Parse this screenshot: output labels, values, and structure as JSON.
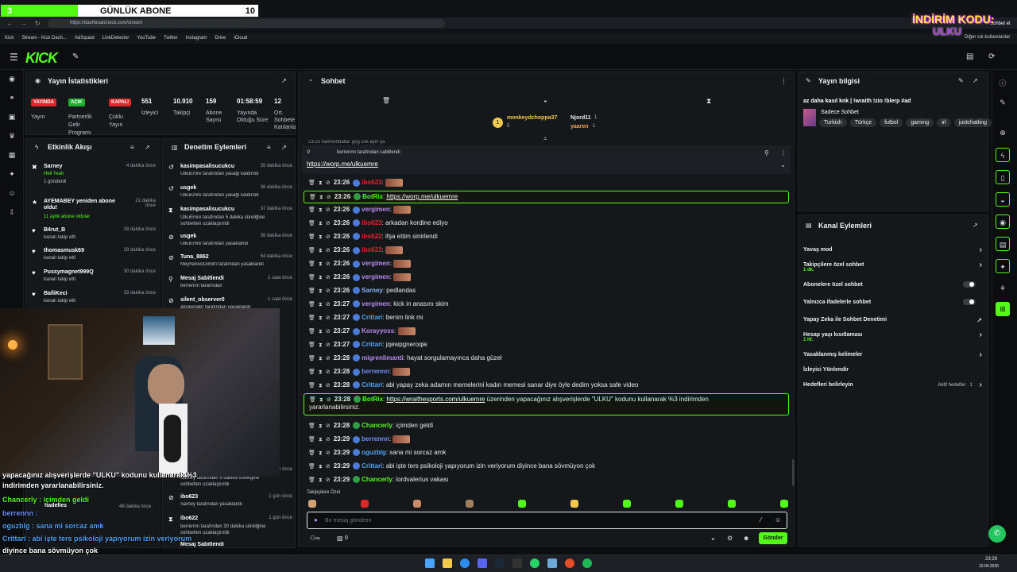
{
  "overlay": {
    "sub_goal_title": "GÜNLÜK ABONE",
    "sub_goal_current": "3",
    "sub_goal_target": "10",
    "sub_goal_progress": 0.3,
    "promo_line1": "İNDİRİM KODU:",
    "promo_line2": "ULKU"
  },
  "browser": {
    "url": "https://dashboard.kick.com/stream",
    "bookmarks": [
      "Kick",
      "Stream - Kick Dash...",
      "AdSquad",
      "LinkDetector",
      "YouTube",
      "Twitter",
      "Instagram",
      "Drive",
      "iCloud"
    ],
    "other_bookmarks": "Diğer sık kullanılanlar",
    "sohbet_btn": "Sohbet et"
  },
  "stats": {
    "title": "Yayın İstatistikleri",
    "badges": [
      {
        "label": "YAYINDA",
        "color": "#e0262b",
        "caption": "Yayın"
      },
      {
        "label": "AÇIK",
        "color": "#1fae2e",
        "caption": "Partnerlik Gelir Programı"
      },
      {
        "label": "KAPALI",
        "color": "#e0262b",
        "caption": "Çoklu Yayın"
      }
    ],
    "items": [
      {
        "value": "551",
        "label": "İzleyici"
      },
      {
        "value": "10.910",
        "label": "Takipçi"
      },
      {
        "value": "159",
        "label": "Abone Sayısı"
      },
      {
        "value": "01:58:59",
        "label": "Yayında Olduğu Süre"
      },
      {
        "value": "12",
        "label": "Ort. Sohbete Katılanla"
      }
    ]
  },
  "activity": {
    "title": "Etkinlik Akışı",
    "items": [
      {
        "name": "Sarney",
        "sub": "Heil Yeah",
        "extra": "1 gönderdi",
        "time": "4 dakika önce"
      },
      {
        "name": "AYEMABEY yeniden abone oldu!",
        "sub": "11 aylık abone oldular",
        "extra": "",
        "time": "21 dakika önce"
      },
      {
        "name": "B4rut_B",
        "sub": "kanalı takip etti",
        "extra": "",
        "time": "28 dakika önce"
      },
      {
        "name": "thomasmusk69",
        "sub": "kanalı takip etti",
        "extra": "",
        "time": "29 dakika önce"
      },
      {
        "name": "Pussymagnet999Q",
        "sub": "kanalı takip etti",
        "extra": "",
        "time": "30 dakika önce"
      },
      {
        "name": "BalliKeci",
        "sub": "kanalı takip etti",
        "extra": "",
        "time": "33 dakika önce"
      }
    ]
  },
  "moderation": {
    "title": "Denetim Eylemleri",
    "items": [
      {
        "name": "kasimpasalisucukcu",
        "sub": "UlkuEmre tarafından yasağı kaldırıldı",
        "time": "35 dakika önce"
      },
      {
        "name": "usgek",
        "sub": "UlkuEmre tarafından yasağı kaldırıldı",
        "time": "36 dakika önce"
      },
      {
        "name": "kasimpasalisucukcu",
        "sub": "UlkuEmre tarafından 5 dakika süreliğine sohbetten uzaklaştırıldı",
        "time": "37 dakika önce"
      },
      {
        "name": "usgek",
        "sub": "UlkuEmre tarafından yasaklandı",
        "time": "38 dakika önce"
      },
      {
        "name": "Tuna_8862",
        "sub": "MeyhaneciDimitri tarafından yasaklandı",
        "time": "54 dakika önce"
      },
      {
        "name": "Mesaj Sabitlendi",
        "sub": "berrennn tarafından",
        "time": "1 saat önce"
      },
      {
        "name": "silent_observer0",
        "sub": "aloskender tarafından yasaklandı",
        "time": "1 saat önce"
      },
      {
        "name": "tugol12",
        "sub": "Sarney tarafından 5 dakika süreliğine sohbetten uzaklaştırıldı",
        "time": "1 gün önce"
      },
      {
        "name": "hadelles",
        "sub": "",
        "time": "48 dakika önce"
      },
      {
        "name": "ibo623",
        "sub": "Sarney tarafından yasaklandı",
        "time": "1 gün önce"
      },
      {
        "name": "ibo622",
        "sub": "berrennn tarafından 30 dakika süreliğine sohbetten uzaklaştırıldı",
        "time": "1 gün önce"
      },
      {
        "name": "Mesaj Sabitlendi",
        "sub": "",
        "time": ""
      }
    ]
  },
  "chat": {
    "title": "Sohbet",
    "top_gifters": [
      {
        "name": "monkeydchoppa37",
        "count": "5"
      },
      {
        "name": "Njord11",
        "count": "1"
      },
      {
        "name": "yaaren",
        "count": "1"
      }
    ],
    "cut_line": "23:25 hamrkinbaba: gog cok ayin ya",
    "pinned_by": "berrennn tarafından sabitlendi",
    "pinned_link": "https://worp.me/ulkuemre",
    "messages": [
      {
        "time": "23:26",
        "user": "ibo623",
        "color": "#e0262b",
        "text": "",
        "emote": true,
        "hl": false
      },
      {
        "time": "23:26",
        "user": "BotRix",
        "color": "#53fc18",
        "text": "",
        "link": "https://worp.me/ulkuemre",
        "hl": true
      },
      {
        "time": "23:26",
        "user": "vergimen",
        "color": "#b98af2",
        "text": "",
        "emote": true,
        "hl": false
      },
      {
        "time": "23:26",
        "user": "ibo623",
        "color": "#e0262b",
        "text": "arkadan kordine ediyo",
        "hl": false
      },
      {
        "time": "23:26",
        "user": "ibo622",
        "color": "#e0262b",
        "text": "ifşa ettim sinirlendi",
        "hl": false
      },
      {
        "time": "23:26",
        "user": "ibo623",
        "color": "#e0262b",
        "text": "",
        "emote": true,
        "hl": false
      },
      {
        "time": "23:26",
        "user": "vergimen",
        "color": "#b98af2",
        "text": "",
        "emote": true,
        "hl": false
      },
      {
        "time": "23:26",
        "user": "vergimen",
        "color": "#b98af2",
        "text": "",
        "emote": true,
        "hl": false
      },
      {
        "time": "23:26",
        "user": "Sarney",
        "color": "#8ab4f8",
        "text": "pedlandas",
        "hl": false
      },
      {
        "time": "23:27",
        "user": "vergimen",
        "color": "#b98af2",
        "text": "kick in anasını skim",
        "hl": false
      },
      {
        "time": "23:27",
        "user": "Crittari",
        "color": "#4fa3f7",
        "text": "benim link mi",
        "hl": false
      },
      {
        "time": "23:27",
        "user": "Korayyoss",
        "color": "#b98af2",
        "text": "",
        "emote": true,
        "hl": false
      },
      {
        "time": "23:27",
        "user": "Crittari",
        "color": "#4fa3f7",
        "text": "jqewpgneroqie",
        "hl": false
      },
      {
        "time": "23:28",
        "user": "migrenlimanti",
        "color": "#b98af2",
        "text": "hayat sorgulamayınca daha güzel",
        "hl": false
      },
      {
        "time": "23:28",
        "user": "berrennn",
        "color": "#6f8ff7",
        "text": "",
        "emote": true,
        "hl": false
      },
      {
        "time": "23:28",
        "user": "Crittari",
        "color": "#4fa3f7",
        "text": "abi yapay zeka adamın memelerini kadın memesi sanar diye öyle dedim yoksa safe video",
        "hl": false
      },
      {
        "time": "23:28",
        "user": "BotRix",
        "color": "#53fc18",
        "text": "üzerinden yapacağınız alışverişlerde \"ULKU\" kodunu kullanarak %3 indirimden",
        "text2": "yararlanabilirsiniz.",
        "link": "https://wraithesports.com/ulkuemre",
        "hl": true
      },
      {
        "time": "23:28",
        "user": "Chancerly",
        "color": "#53fc18",
        "text": "içimden geldi",
        "hl": false
      },
      {
        "time": "23:29",
        "user": "berrennn",
        "color": "#6f8ff7",
        "text": "",
        "emote": true,
        "hl": false
      },
      {
        "time": "23:29",
        "user": "oguzblg",
        "color": "#4fa3f7",
        "text": "sana mi sorcaz amk",
        "hl": false
      },
      {
        "time": "23:29",
        "user": "Crittari",
        "color": "#4fa3f7",
        "text": "abi işte ters psikoloji yapıyorum izin veriyorum diyince bana sövmüyon çok",
        "hl": false
      },
      {
        "time": "23:29",
        "user": "Chancerly",
        "color": "#53fc18",
        "text": "lordvalerius vakası",
        "hl": false
      }
    ],
    "followers_only_label": "Takipçilere Özel",
    "input_placeholder": "Bir mesaj gönderin",
    "send_label": "Gönder",
    "count_a": "0"
  },
  "info": {
    "title": "Yayın bilgisi",
    "stream_title": "az daha kasıl knk | !wraith !zio !blerp #ad",
    "category": "Sadece Sohbet",
    "tags": [
      "Turkish",
      "Türkçe",
      "futbol",
      "gaming",
      "irl",
      "justchatting"
    ]
  },
  "channel_actions": {
    "title": "Kanal Eylemleri",
    "rows": [
      {
        "label": "Yavaş mod",
        "type": "chev",
        "sub": ""
      },
      {
        "label": "Takipçilere özel sohbet",
        "type": "chev",
        "sub": "1 dk."
      },
      {
        "label": "Abonelere özel sohbet",
        "type": "toggle",
        "sub": ""
      },
      {
        "label": "Yalnızca ifadelerle sohbet",
        "type": "toggle",
        "sub": ""
      },
      {
        "label": "Yapay Zeka ile Sohbet Denetimi",
        "type": "ext",
        "sub": ""
      },
      {
        "label": "Hesap yaşı kısıtlaması",
        "type": "chev",
        "sub": "1 hf."
      },
      {
        "label": "Yasaklanmış kelimeler",
        "type": "chev",
        "sub": ""
      },
      {
        "label": "İzleyici Yönlendir",
        "type": "none",
        "sub": ""
      },
      {
        "label": "Hedefleri belirleyin",
        "type": "chev",
        "sub": "",
        "right": "Aktif hedefler · 1"
      }
    ]
  },
  "stream_overlay_chat": [
    {
      "text": "yapacağınız alışverişlerde \"ULKU\" kodunu kullanarak %3",
      "color": "#ffffff"
    },
    {
      "text": "indirimden yararlanabilirsiniz.",
      "color": "#ffffff"
    },
    {
      "text": "Chancerly : içimden geldi",
      "color": "#53fc18"
    },
    {
      "text": "berrennn :",
      "color": "#6f8ff7"
    },
    {
      "text": "oguzblg : sana mi sorcaz amk",
      "color": "#4fa3f7"
    },
    {
      "text": "Crittari : abi işte ters psikoloji yapıyorum izin veriyorum",
      "color": "#4fa3f7"
    },
    {
      "text": "diyince bana sövmüyon çok",
      "color": "#ffffff"
    },
    {
      "text": "Chancerly : lordvalerius vakası",
      "color": "#53fc18"
    }
  ],
  "clock": {
    "time": "23:29",
    "date": "10.04.2026"
  }
}
